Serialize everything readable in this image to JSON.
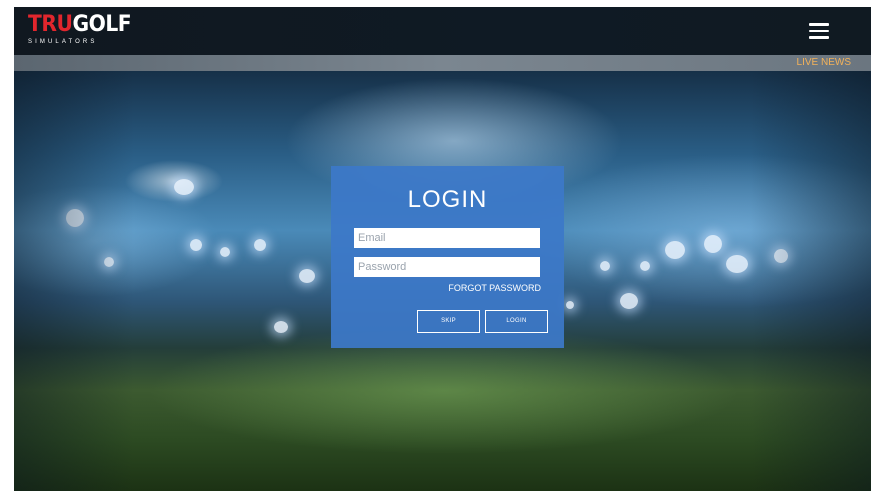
{
  "brand": {
    "tru": "TRU",
    "golf": "GOLF",
    "sub": "SIMULATORS"
  },
  "header": {
    "menu_icon": "hamburger-menu-icon",
    "live_news": "LIVE NEWS"
  },
  "login": {
    "title": "LOGIN",
    "email_placeholder": "Email",
    "password_placeholder": "Password",
    "forgot": "FORGOT PASSWORD",
    "skip": "SKIP",
    "login": "LOGIN"
  },
  "colors": {
    "brand_red": "#e1262d",
    "panel_blue": "#3c78c8",
    "live_news": "#f3b25a"
  }
}
